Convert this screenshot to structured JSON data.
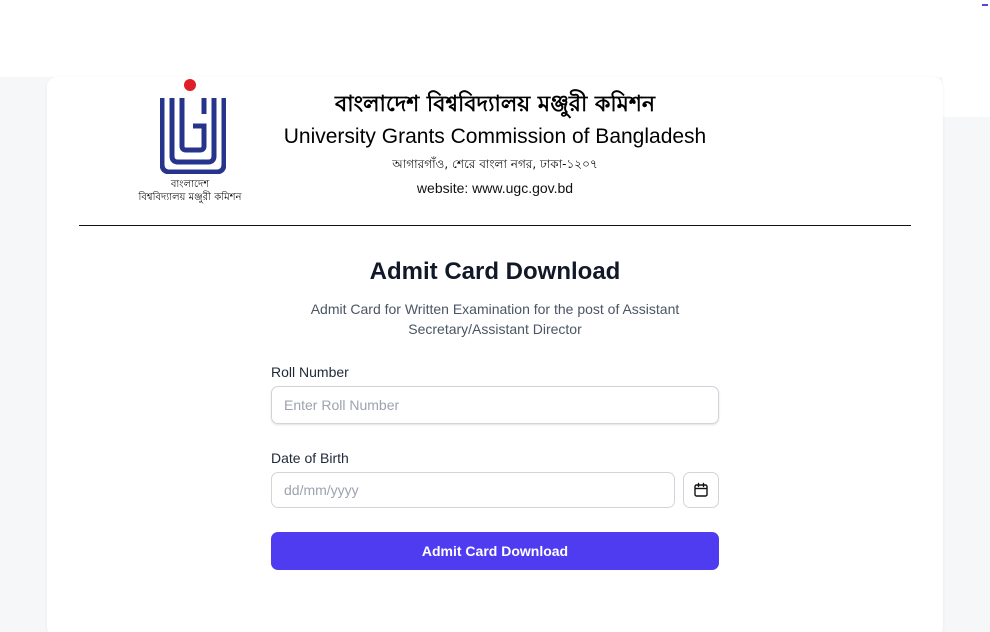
{
  "header": {
    "logo_caption_line1": "বাংলাদেশ",
    "logo_caption_line2": "বিশ্ববিদ্যালয় মঞ্জুরী কমিশন",
    "title_bn": "বাংলাদেশ বিশ্ববিদ্যালয় মঞ্জুরী কমিশন",
    "title_en": "University Grants Commission of Bangladesh",
    "address_bn": "আগারগাঁও, শেরে বাংলা নগর, ঢাকা-১২০৭",
    "website": "website: www.ugc.gov.bd"
  },
  "form": {
    "title": "Admit Card Download",
    "subtitle": "Admit Card for Written Examination for the post of Assistant Secretary/Assistant Director",
    "roll_label": "Roll Number",
    "roll_placeholder": "Enter Roll Number",
    "roll_value": "",
    "dob_label": "Date of Birth",
    "dob_placeholder": "dd/mm/yyyy",
    "dob_value": "",
    "submit_label": "Admit Card Download"
  },
  "icons": {
    "calendar": "calendar-icon",
    "logo": "ugc-logo-icon"
  },
  "colors": {
    "accent": "#4f3cf0",
    "logo_blue": "#27348b",
    "logo_red": "#e11d2a"
  }
}
